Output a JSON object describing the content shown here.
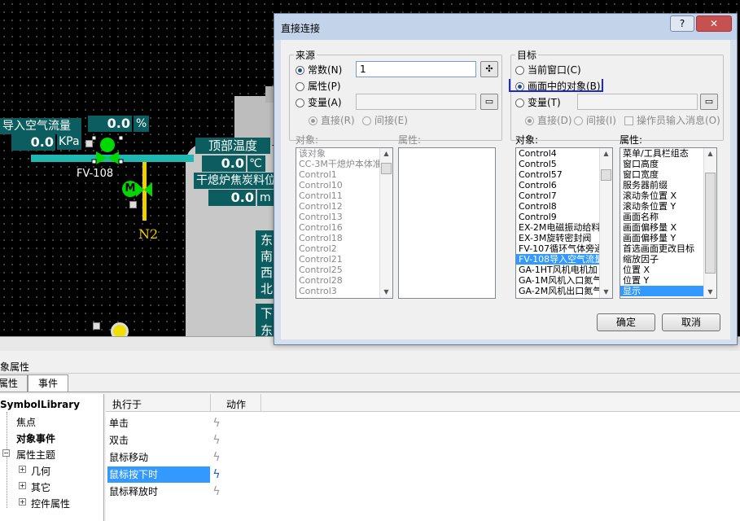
{
  "canvas": {
    "flow_label": "导入空气流量",
    "flow_value": "0.0",
    "flow_unit": "KPa",
    "pct_value": "0.0",
    "pct_unit": "%",
    "valve_tag": "FV-108",
    "motor_letter": "M",
    "n2_label": "N2",
    "temp_label": "顶部温度",
    "temp_value": "0.0",
    "temp_unit": "℃",
    "coke_label": "干熄炉焦炭料位",
    "coke_value": "0.0",
    "coke_unit": "m",
    "side_labels": [
      "东",
      "南",
      "西",
      "北",
      "下",
      "东"
    ]
  },
  "dialog": {
    "title": "直接连接",
    "help_btn": "?",
    "close_btn": "✕",
    "source": {
      "group_title": "来源",
      "constant": "常数(N)",
      "property": "属性(P)",
      "variable": "变量(A)",
      "constant_value": "1",
      "direct": "直接(R)",
      "indirect": "间接(E)",
      "objects_label": "对象:",
      "props_label": "属性:",
      "objects": [
        "该对象",
        "CC-3M干熄炉本体准",
        "Control1",
        "Control10",
        "Control11",
        "Control12",
        "Control13",
        "Control16",
        "Control18",
        "Control2",
        "Control21",
        "Control25",
        "Control28",
        "Control3"
      ]
    },
    "target": {
      "group_title": "目标",
      "current_window": "当前窗口(C)",
      "object_in_picture": "画面中的对象(B)",
      "variable": "变量(T)",
      "direct": "直接(D)",
      "indirect": "间接(I)",
      "operator_msg": "操作员输入消息(O)",
      "objects_label": "对象:",
      "props_label": "属性:",
      "objects": [
        "Control4",
        "Control5",
        "Control57",
        "Control6",
        "Control7",
        "Control8",
        "Control9",
        "EX-2M电磁振动给料",
        "EX-3M旋转密封阀",
        "FV-107循环气体旁通",
        "FV-108导入空气流量",
        "GA-1HT风机电机加",
        "GA-1M风机入口氮气",
        "GA-2M风机出口氮气"
      ],
      "selected_object": "FV-108导入空气流量",
      "properties": [
        "菜单/工具栏组态",
        "窗口高度",
        "窗口宽度",
        "服务器前缀",
        "滚动条位置 X",
        "滚动条位置 Y",
        "画面名称",
        "画面偏移量 X",
        "画面偏移量 Y",
        "首选画面更改目标",
        "缩放因子",
        "位置 X",
        "位置 Y",
        "显示"
      ],
      "selected_property": "显示"
    },
    "ok": "确定",
    "cancel": "取消"
  },
  "panel": {
    "title": "象属性",
    "tab_props": "属性",
    "tab_events": "事件",
    "tree": {
      "root": "SymbolLibrary",
      "focus": "焦点",
      "object_events": "对象事件",
      "property_topics": "属性主题",
      "geometry": "几何",
      "other": "其它",
      "control_props": "控件属性"
    },
    "grid": {
      "col_exec": "执行于",
      "col_action": "动作",
      "rows": [
        "单击",
        "双击",
        "鼠标移动",
        "鼠标按下时",
        "鼠标释放时"
      ],
      "selected_row": "鼠标按下时"
    }
  },
  "colors": {
    "accent": "#0b5d60",
    "pipe": "#1fb7b1",
    "selection": "#3399ff",
    "valve_green": "#00d800",
    "n2_yellow": "#f0d000"
  }
}
